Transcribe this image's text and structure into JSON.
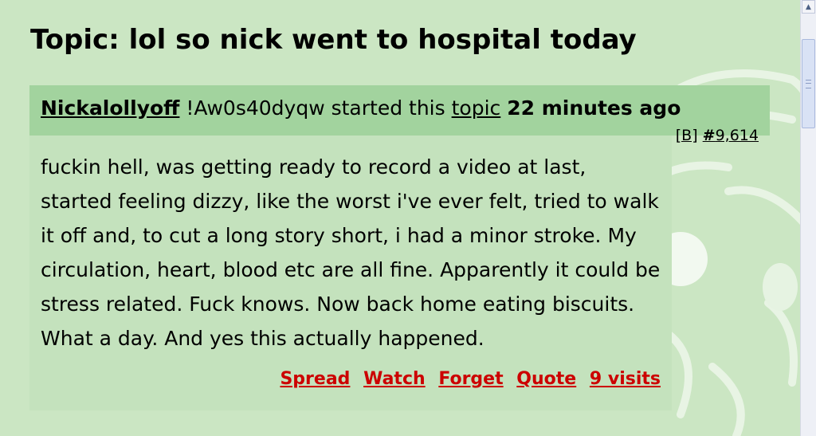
{
  "topic": {
    "title": "Topic: lol so nick went to hospital today"
  },
  "post": {
    "author": "Nickalollyoff",
    "tripcode": "!Aw0s40dyqw",
    "started_text": "started this",
    "topic_link": "topic",
    "age": "22 minutes ago",
    "b_link": "[B]",
    "number_prefix": "#",
    "number": "9,614",
    "body": "fuckin hell, was getting ready to record a video at last, started feeling dizzy, like the worst i've ever felt, tried to walk it off and, to cut a long story short, i had a minor stroke. My circulation, heart, blood etc are all fine. Apparently it could be stress related. Fuck knows. Now back home eating biscuits. What a day. And yes this actually happened."
  },
  "actions": {
    "spread": "Spread",
    "watch": "Watch",
    "forget": "Forget",
    "quote": "Quote",
    "visits": "9 visits"
  },
  "colors": {
    "page_bg": "#cbe6c3",
    "header_bg": "#a2d39e",
    "body_bg": "#c4e2bd",
    "action_link": "#cc0000"
  },
  "icons": {
    "background": "mascot-watermark",
    "scroll_up": "scroll-up-arrow-icon"
  }
}
